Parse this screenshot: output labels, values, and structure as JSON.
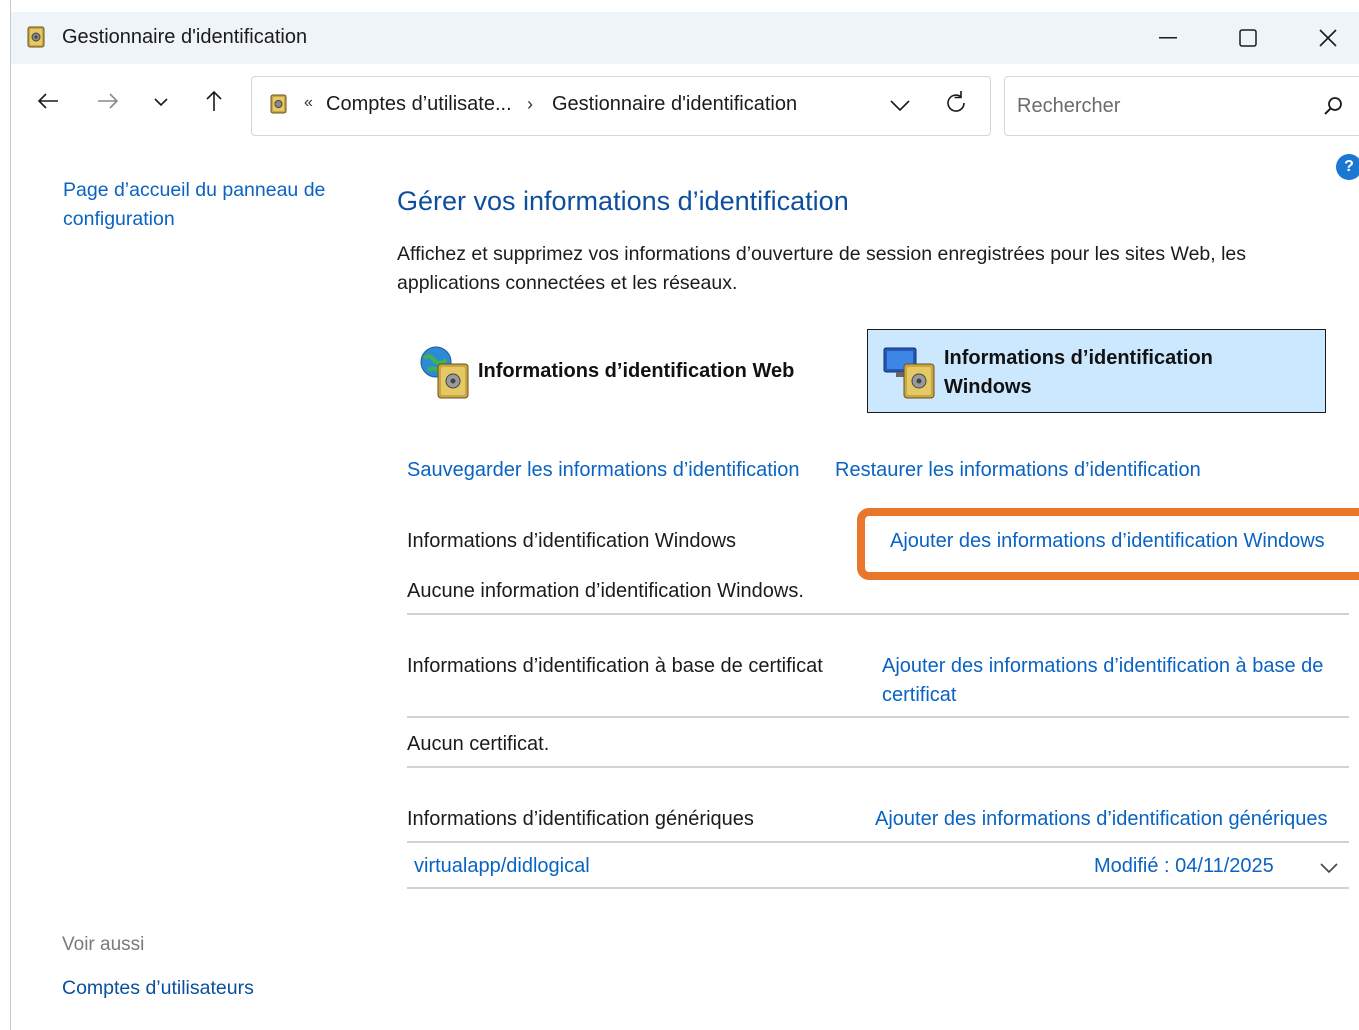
{
  "window": {
    "title": "Gestionnaire d'identification",
    "controls": {
      "minimize": "minimize-icon",
      "maximize": "maximize-icon",
      "close": "close-icon"
    }
  },
  "nav": {
    "breadcrumb_prefix": "«",
    "breadcrumb": [
      "Comptes d’utilisate...",
      "Gestionnaire d'identification"
    ],
    "breadcrumb_separator": "›",
    "search_placeholder": "Rechercher"
  },
  "left_pane": {
    "home_link": "Page d’accueil du panneau de configuration",
    "see_also": "Voir aussi",
    "accounts_link": "Comptes d’utilisateurs"
  },
  "help": "?",
  "main": {
    "title": "Gérer vos informations d’identification",
    "description": "Affichez et supprimez vos informations d’ouverture de session enregistrées pour les sites Web, les applications connectées et les réseaux.",
    "cred_web": "Informations d’identification Web",
    "cred_windows": "Informations d’identification Windows",
    "backup_link": "Sauvegarder les informations d’identification",
    "restore_link": "Restaurer les informations d’identification",
    "sections": {
      "windows": {
        "heading": "Informations d’identification Windows",
        "add_link": "Ajouter des informations d’identification Windows",
        "empty": "Aucune information d’identification Windows."
      },
      "certificate": {
        "heading": "Informations d’identification à base de certificat",
        "add_link": "Ajouter des informations d’identification à base de certificat",
        "empty": "Aucun certificat."
      },
      "generic": {
        "heading": "Informations d’identification génériques",
        "add_link": "Ajouter des informations d’identification génériques",
        "entries": [
          {
            "name": "virtualapp/didlogical",
            "modified": "Modifié :  04/11/2025"
          }
        ]
      }
    }
  },
  "colors": {
    "link": "#0a63c2",
    "title": "#0d4f9e",
    "selected_bg": "#cce8ff",
    "highlight": "#e9762b"
  }
}
